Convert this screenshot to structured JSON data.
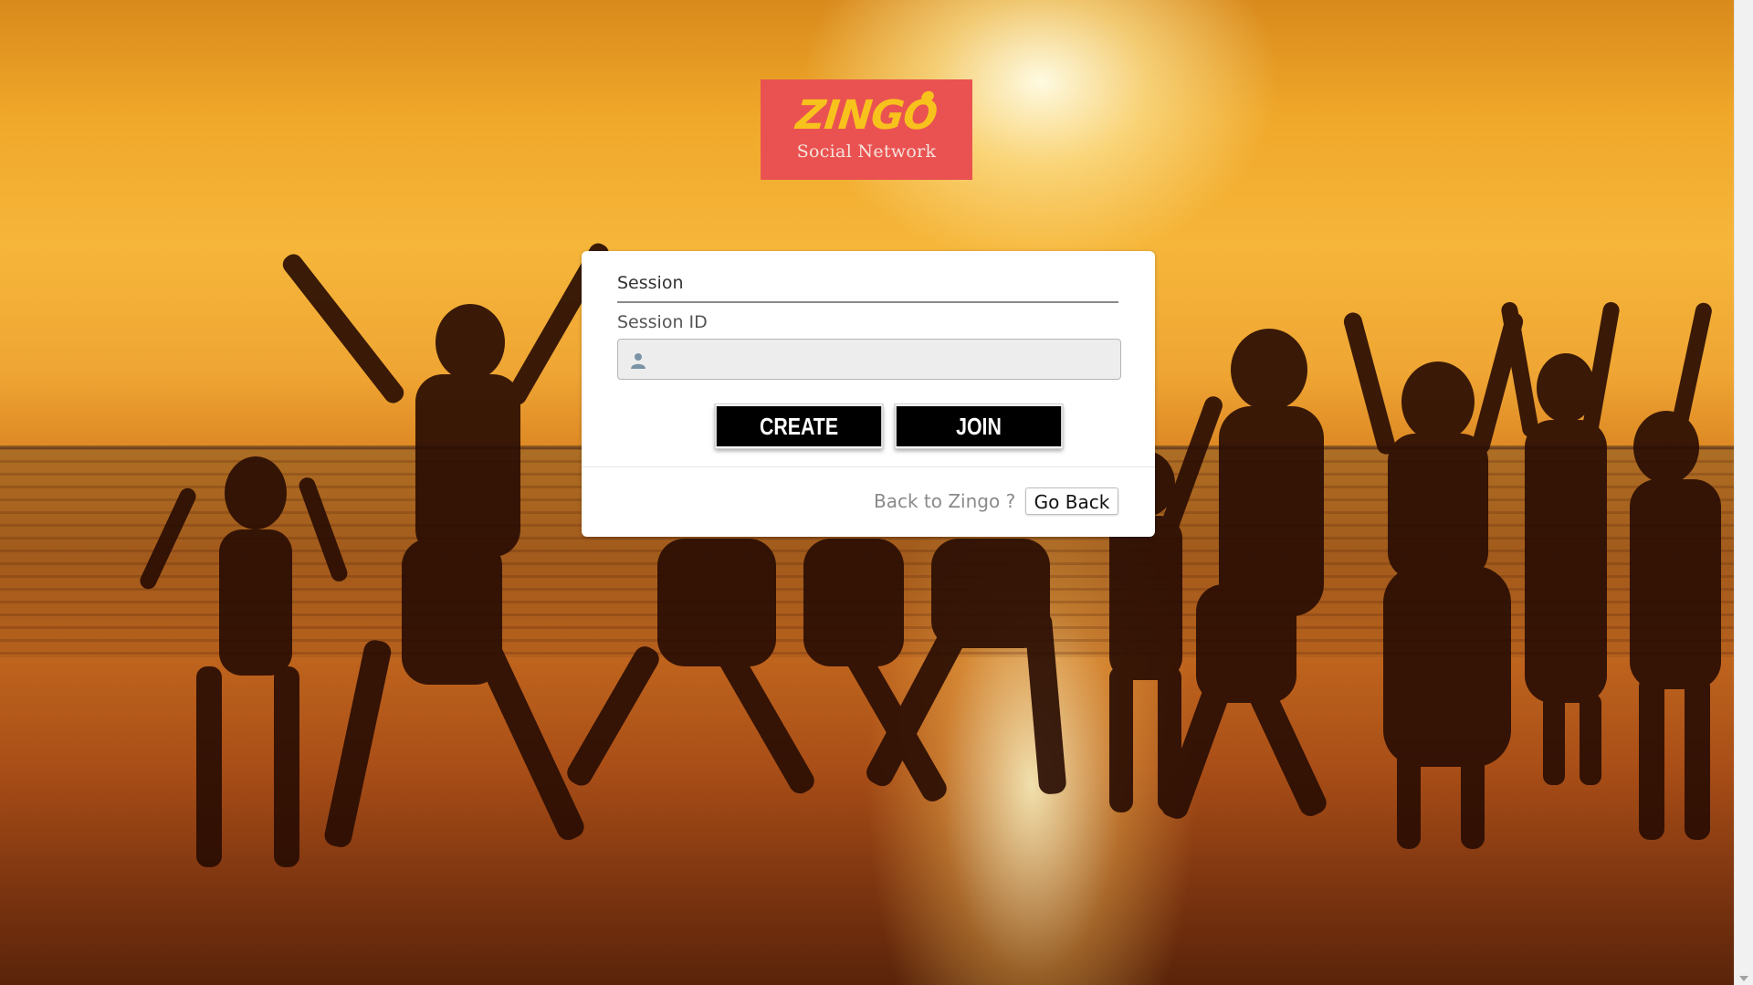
{
  "logo": {
    "title": "ZINGO",
    "subtitle": "Social Network"
  },
  "session_panel": {
    "title": "Session",
    "field_label": "Session ID",
    "session_input": {
      "value": "",
      "placeholder": ""
    },
    "user_icon": "user-icon",
    "create_label": "CREATE",
    "join_label": "JOIN"
  },
  "footer": {
    "prompt": "Back to Zingo ?",
    "go_back_label": "Go Back"
  },
  "colors": {
    "logo_background": "#ea5252",
    "logo_title": "#f8c21c",
    "button_background": "#000000",
    "button_text": "#ffffff"
  }
}
